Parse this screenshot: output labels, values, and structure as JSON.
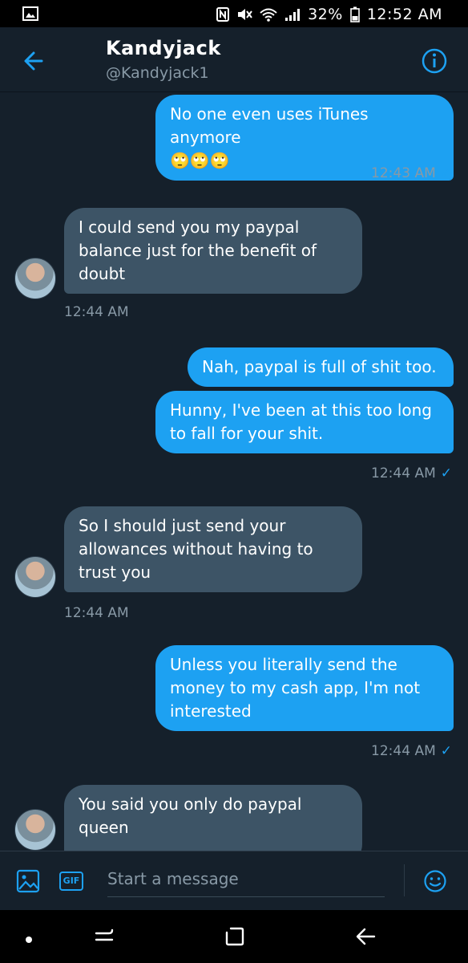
{
  "status_bar": {
    "battery": "32%",
    "time": "12:52 AM"
  },
  "header": {
    "name": "Kandyjack",
    "handle": "@Kandyjack1"
  },
  "messages": [
    {
      "dir": "out",
      "text": "No one even uses iTunes anymore\n🙄🙄🙄"
    },
    {
      "dir": "out_ts",
      "time": "12:43 AM"
    },
    {
      "dir": "in",
      "text": "I could send you my paypal balance just for the benefit of doubt"
    },
    {
      "dir": "in_ts",
      "time": "12:44 AM"
    },
    {
      "dir": "out",
      "text": "Nah, paypal is full of shit too."
    },
    {
      "dir": "out",
      "text": "Hunny, I've been at this too long to fall for your shit."
    },
    {
      "dir": "out_ts",
      "time": "12:44 AM"
    },
    {
      "dir": "in",
      "text": "So I should just send your allowances without having to trust you"
    },
    {
      "dir": "in_ts",
      "time": "12:44 AM"
    },
    {
      "dir": "out",
      "text": "Unless you literally send the money to my cash app, I'm not interested"
    },
    {
      "dir": "out_ts",
      "time": "12:44 AM"
    },
    {
      "dir": "in",
      "text": "You said you only do paypal queen"
    }
  ],
  "composer": {
    "gif_label": "GIF",
    "placeholder": "Start a message"
  },
  "colors": {
    "background": "#15202b",
    "accent": "#1da1f2",
    "incoming_bubble": "#3d5466",
    "muted_text": "#8899a6"
  },
  "icons": [
    "gallery-icon",
    "nfc-icon",
    "mute-icon",
    "wifi-icon",
    "signal-icon",
    "battery-icon",
    "back-arrow-icon",
    "info-icon",
    "image-icon",
    "emoji-icon",
    "home-icon",
    "recents-icon",
    "nav-back-icon"
  ]
}
